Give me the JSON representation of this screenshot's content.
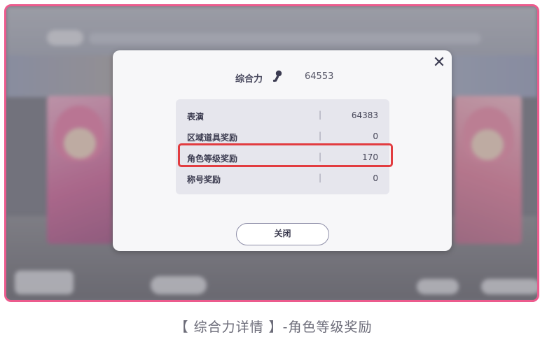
{
  "dialog": {
    "close_icon": "close-icon",
    "power": {
      "label": "综合力",
      "icon": "microphone-icon",
      "value": "64553"
    },
    "rows": [
      {
        "label": "表演",
        "sep": "|",
        "value": "64383"
      },
      {
        "label": "区域道具奖励",
        "sep": "|",
        "value": "0"
      },
      {
        "label": "角色等级奖励",
        "sep": "|",
        "value": "170"
      },
      {
        "label": "称号奖励",
        "sep": "|",
        "value": "0"
      }
    ],
    "close_button": "关闭"
  },
  "caption": "【 综合力详情 】-角色等级奖励",
  "colors": {
    "frame_border": "#ec5b8d",
    "highlight": "#e23c40",
    "dialog_bg": "#f7f7f9",
    "table_bg": "#e6e6ed"
  }
}
